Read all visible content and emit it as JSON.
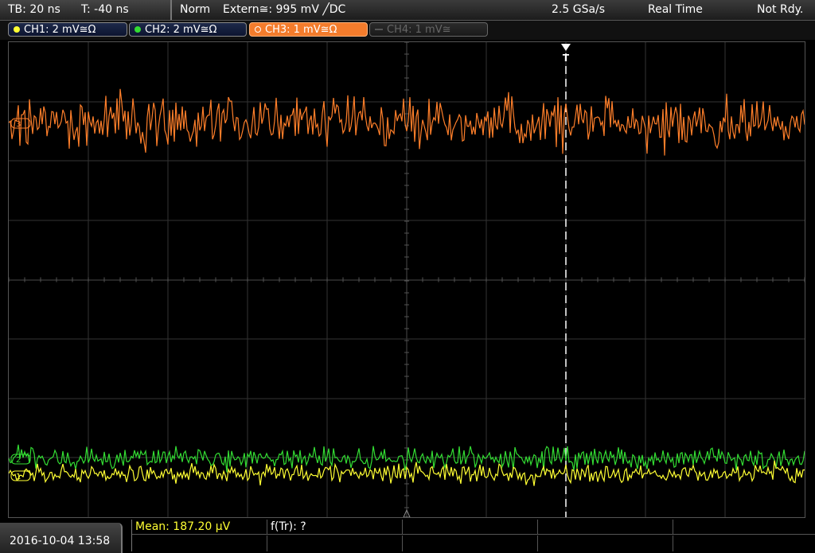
{
  "topbar": {
    "timebase": "TB: 20 ns",
    "trigger_time": "T: -40 ns",
    "trigger_mode": "Norm",
    "trigger_source": "Extern≅: 995 mV ╱DC",
    "sample_rate": "2.5 GSa/s",
    "acq_mode": "Real Time",
    "status": "Not Rdy."
  },
  "channels": [
    {
      "label": "CH1: 2 mV≅Ω",
      "color": "#ffff33",
      "state": "on"
    },
    {
      "label": "CH2: 2 mV≅Ω",
      "color": "#33dd33",
      "state": "on"
    },
    {
      "label": "CH3: 1 mV≅Ω",
      "color": "#ff7f2a",
      "state": "active"
    },
    {
      "label": "CH4: 1 mV≅",
      "color": "#666666",
      "state": "off"
    }
  ],
  "markers": {
    "trigger": "T",
    "ch3_marker": "3",
    "ch2_marker": "2",
    "ch1_marker": "1"
  },
  "bottom": {
    "datetime": "2016-10-04 13:58",
    "meas1": "Mean: 187.20 µV",
    "meas2": "f(Tr): ?"
  },
  "colors": {
    "ch1": "#ffff33",
    "ch2": "#33dd33",
    "ch3": "#ff7f2a",
    "grid": "#444444",
    "meas_yellow": "#ffff33"
  }
}
